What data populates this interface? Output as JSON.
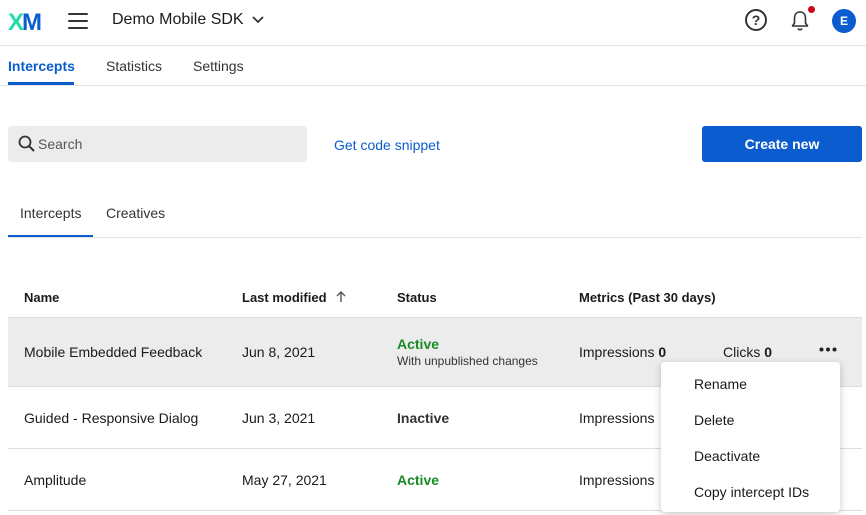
{
  "header": {
    "logo_x": "X",
    "logo_m": "M",
    "project_name": "Demo Mobile SDK",
    "help_symbol": "?",
    "avatar_initial": "E"
  },
  "top_tabs": [
    {
      "label": "Intercepts",
      "active": true
    },
    {
      "label": "Statistics",
      "active": false
    },
    {
      "label": "Settings",
      "active": false
    }
  ],
  "toolbar": {
    "search_placeholder": "Search",
    "snippet_label": "Get code snippet",
    "create_label": "Create new"
  },
  "sub_tabs": [
    {
      "label": "Intercepts",
      "active": true
    },
    {
      "label": "Creatives",
      "active": false
    }
  ],
  "table": {
    "columns": [
      "Name",
      "Last modified",
      "Status",
      "Metrics (Past 30 days)"
    ],
    "rows": [
      {
        "name": "Mobile Embedded Feedback",
        "modified": "Jun 8, 2021",
        "status": "Active",
        "status_note": "With unpublished changes",
        "impressions_label": "Impressions",
        "impressions": "0",
        "clicks_label": "Clicks",
        "clicks": "0"
      },
      {
        "name": "Guided - Responsive Dialog",
        "modified": "Jun 3, 2021",
        "status": "Inactive",
        "impressions_label": "Impressions"
      },
      {
        "name": "Amplitude",
        "modified": "May 27, 2021",
        "status": "Active",
        "impressions_label": "Impressions"
      }
    ]
  },
  "context_menu": {
    "items": [
      "Rename",
      "Delete",
      "Deactivate",
      "Copy intercept IDs"
    ]
  },
  "colors": {
    "accent": "#0b5cce",
    "active_status": "#1a8a26",
    "notification": "#d0021b",
    "logo_x": "#21dbaa"
  }
}
